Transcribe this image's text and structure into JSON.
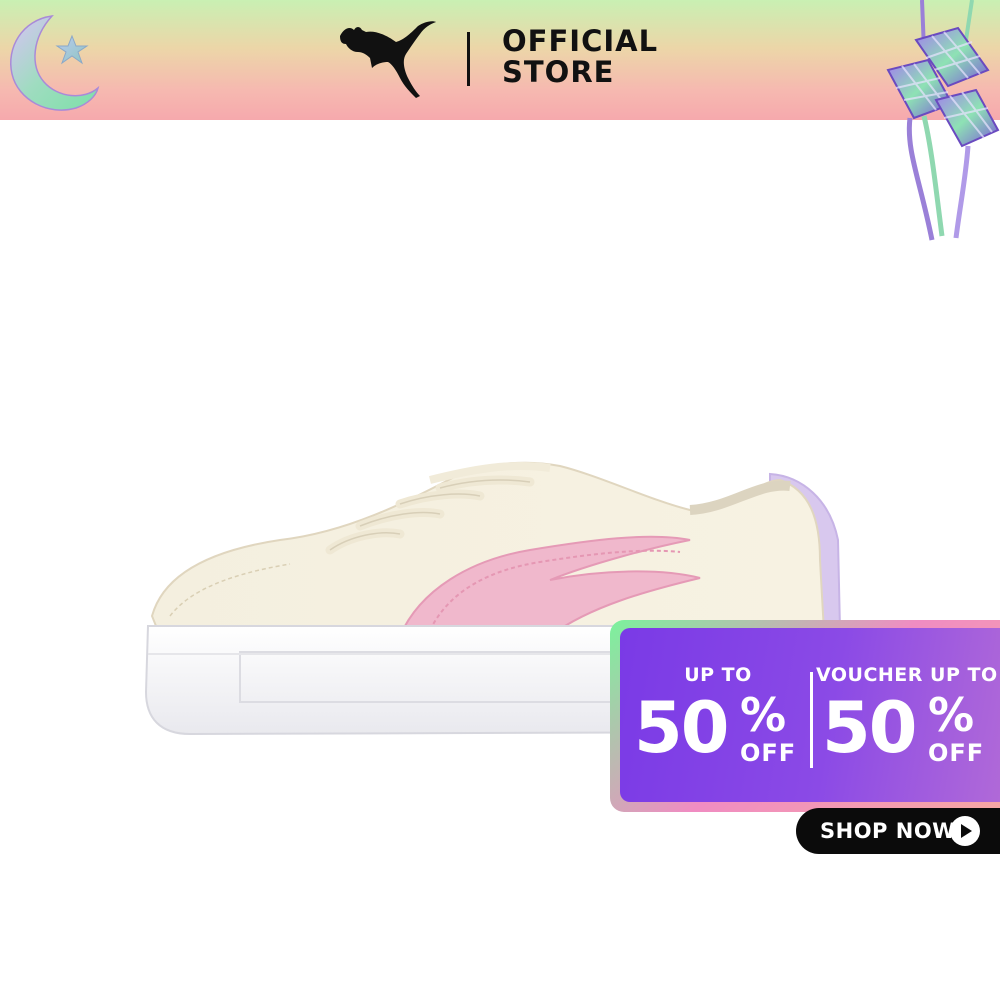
{
  "header": {
    "store_line1": "OFFICIAL",
    "store_line2": "STORE",
    "logo_icon": "puma-cat-logo-icon",
    "decor_left_icon": "crescent-moon-star-icon",
    "decor_right_icon": "ketupat-ornament-icon",
    "colors": {
      "top": "#c9f0b3",
      "bottom": "#f6a9ad"
    }
  },
  "product": {
    "image_icon": "sneaker-product-image"
  },
  "promo": {
    "left": {
      "lead": "UP TO",
      "number": "50",
      "percent": "%",
      "off": "OFF"
    },
    "right": {
      "lead": "VOUCHER UP TO",
      "number": "50",
      "percent": "%",
      "off": "OFF"
    },
    "colors": {
      "panel": "#7a3ae6",
      "border": "#7bf29c"
    }
  },
  "cta": {
    "label": "SHOP NOW",
    "arrow_icon": "arrow-right-icon"
  }
}
